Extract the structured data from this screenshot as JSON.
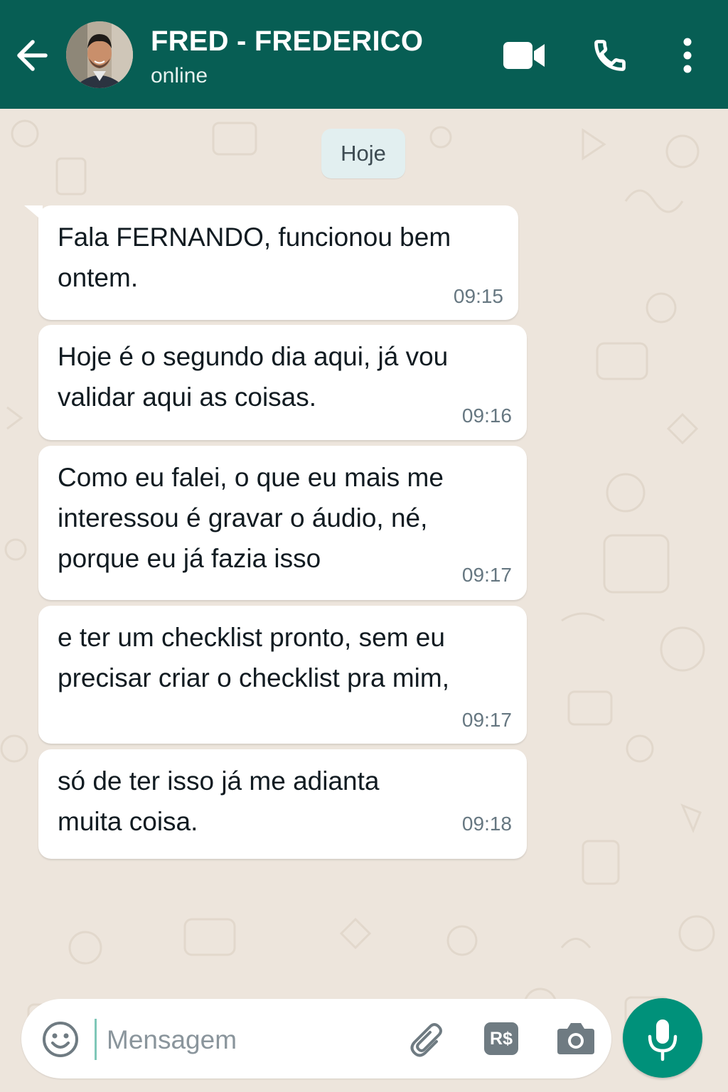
{
  "header": {
    "contact_name": "FRED - FREDERICO",
    "status": "online",
    "icons": [
      "back-arrow-icon",
      "video-call-icon",
      "voice-call-icon",
      "more-options-icon"
    ]
  },
  "chat": {
    "date_label": "Hoje",
    "messages": [
      {
        "text": "Fala FERNANDO, funcionou bem\nontem.",
        "time": "09:15"
      },
      {
        "text": "Hoje é o segundo dia aqui, já vou\nvalidar aqui as coisas.",
        "time": "09:16"
      },
      {
        "text": "Como eu falei, o que eu mais me\ninteressou é gravar o áudio, né,\nporque eu já fazia isso",
        "time": "09:17"
      },
      {
        "text": "e ter um checklist pronto, sem eu\nprecisar criar o checklist pra mim,",
        "time": "09:17"
      },
      {
        "text": "só de ter isso já me adianta\nmuita coisa.",
        "time": "09:18"
      }
    ]
  },
  "composer": {
    "placeholder": "Mensagem",
    "value": "",
    "payment_label": "R$",
    "icons": [
      "emoji-icon",
      "attach-icon",
      "payment-icon",
      "camera-icon",
      "microphone-icon"
    ]
  },
  "colors": {
    "header_bg": "#075e54",
    "chat_bg": "#ede5dc",
    "bubble_bg": "#ffffff",
    "mic_button": "#00917a"
  }
}
